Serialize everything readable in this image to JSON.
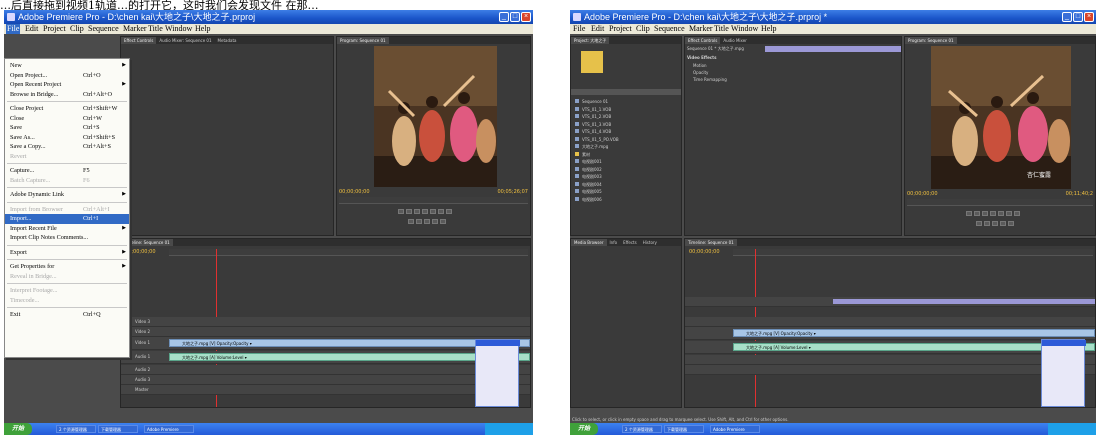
{
  "page_caption": "…后直接拖到视频1轨道…的打开它，这时我们会发现文件 在那…",
  "left": {
    "window_title": "Adobe Premiere Pro - D:\\chen kai\\大地之子\\大地之子.prproj",
    "menu": [
      "File",
      "Edit",
      "Project",
      "Clip",
      "Sequence",
      "Marker",
      "Title",
      "Window",
      "Help"
    ],
    "file_menu": [
      {
        "label": "New",
        "shortcut": "",
        "submenu": true,
        "disabled": false
      },
      {
        "label": "Open Project...",
        "shortcut": "Ctrl+O",
        "submenu": false,
        "disabled": false
      },
      {
        "label": "Open Recent Project",
        "shortcut": "",
        "submenu": true,
        "disabled": false
      },
      {
        "label": "Browse in Bridge...",
        "shortcut": "Ctrl+Alt+O",
        "submenu": false,
        "disabled": false
      },
      {
        "sep": true
      },
      {
        "label": "Close Project",
        "shortcut": "Ctrl+Shift+W",
        "submenu": false,
        "disabled": false
      },
      {
        "label": "Close",
        "shortcut": "Ctrl+W",
        "submenu": false,
        "disabled": false
      },
      {
        "label": "Save",
        "shortcut": "Ctrl+S",
        "submenu": false,
        "disabled": false
      },
      {
        "label": "Save As...",
        "shortcut": "Ctrl+Shift+S",
        "submenu": false,
        "disabled": false
      },
      {
        "label": "Save a Copy...",
        "shortcut": "Ctrl+Alt+S",
        "submenu": false,
        "disabled": false
      },
      {
        "label": "Revert",
        "shortcut": "",
        "submenu": false,
        "disabled": true
      },
      {
        "sep": true
      },
      {
        "label": "Capture...",
        "shortcut": "F5",
        "submenu": false,
        "disabled": false
      },
      {
        "label": "Batch Capture...",
        "shortcut": "F6",
        "submenu": false,
        "disabled": true
      },
      {
        "sep": true
      },
      {
        "label": "Adobe Dynamic Link",
        "shortcut": "",
        "submenu": true,
        "disabled": false
      },
      {
        "sep": true
      },
      {
        "label": "Import from Browser",
        "shortcut": "Ctrl+Alt+I",
        "submenu": false,
        "disabled": true
      },
      {
        "label": "Import...",
        "shortcut": "Ctrl+I",
        "submenu": false,
        "disabled": false,
        "highlight": true
      },
      {
        "label": "Import Recent File",
        "shortcut": "",
        "submenu": true,
        "disabled": false
      },
      {
        "label": "Import Clip Notes Comments...",
        "shortcut": "",
        "submenu": false,
        "disabled": false
      },
      {
        "sep": true
      },
      {
        "label": "Export",
        "shortcut": "",
        "submenu": true,
        "disabled": false
      },
      {
        "sep": true
      },
      {
        "label": "Get Properties for",
        "shortcut": "",
        "submenu": true,
        "disabled": false
      },
      {
        "label": "Reveal in Bridge...",
        "shortcut": "",
        "submenu": false,
        "disabled": true
      },
      {
        "sep": true
      },
      {
        "label": "Interpret Footage...",
        "shortcut": "",
        "submenu": false,
        "disabled": true
      },
      {
        "label": "Timecode...",
        "shortcut": "",
        "submenu": false,
        "disabled": true
      },
      {
        "sep": true
      },
      {
        "label": "Exit",
        "shortcut": "Ctrl+Q",
        "submenu": false,
        "disabled": false
      }
    ],
    "program_tab": "Program: Sequence 01",
    "sequence_tab": "Timeline: Sequence 01",
    "timecode_left": "00;00;00;00",
    "timecode_right": "00;05;26;07",
    "clip_label": "大地之子.mpg [V]  Opacity:Opacity ▾",
    "audio_clip_label": "大地之子.mpg [A] Volume:Level ▾",
    "track_names": [
      "Video 3",
      "Video 2",
      "Video 1",
      "Audio 1",
      "Audio 2",
      "Audio 3",
      "Master"
    ],
    "taskbar": {
      "start": "开始",
      "tasks": [
        "2 个资源管理器",
        "下载管理器",
        "Adobe Premiere"
      ],
      "clock": ""
    }
  },
  "right": {
    "window_title": "Adobe Premiere Pro - D:\\chen kai\\大地之子\\大地之子.prproj *",
    "menu": [
      "File",
      "Edit",
      "Project",
      "Clip",
      "Sequence",
      "Marker",
      "Title",
      "Window",
      "Help"
    ],
    "project_tab": "Project: 大地之子",
    "effect_controls_tab": "Effect Controls",
    "audio_mixer_tab": "Audio Mixer",
    "program_tab": "Program: Sequence 01",
    "sequence_label": "Sequence 01 * 大地之子.mpg",
    "video_effects": "Video Effects",
    "effects": [
      "Motion",
      "Opacity",
      "Time Remapping"
    ],
    "subtitle": "杏仁蜜露",
    "bin_items": [
      "Sequence 01",
      "VTS_01_1.VOB",
      "VTS_01_2.VOB",
      "VTS_01_3.VOB",
      "VTS_01_4.VOB",
      "VTS_01_5_PO.VOB",
      "大地之子.mpg",
      "素材",
      "电视剧001",
      "电视剧002",
      "电视剧003",
      "电视剧004",
      "电视剧005",
      "电视剧006"
    ],
    "timecode_right": "00;11;40;2",
    "timecode_left": "00;00;00;00",
    "clip_label": "大地之子.mpg [V]  Opacity:Opacity ▾",
    "audio_clip_label": "大地之子.mpg [A] Volume:Level ▾",
    "status_text": "Click to select, or click in empty space and drag to marquee select. Use Shift, Alt, and Ctrl for other options.",
    "taskbar": {
      "start": "开始",
      "tasks": [
        "2 个资源管理器",
        "下载管理器",
        "Adobe Premiere"
      ],
      "clock": ""
    }
  }
}
